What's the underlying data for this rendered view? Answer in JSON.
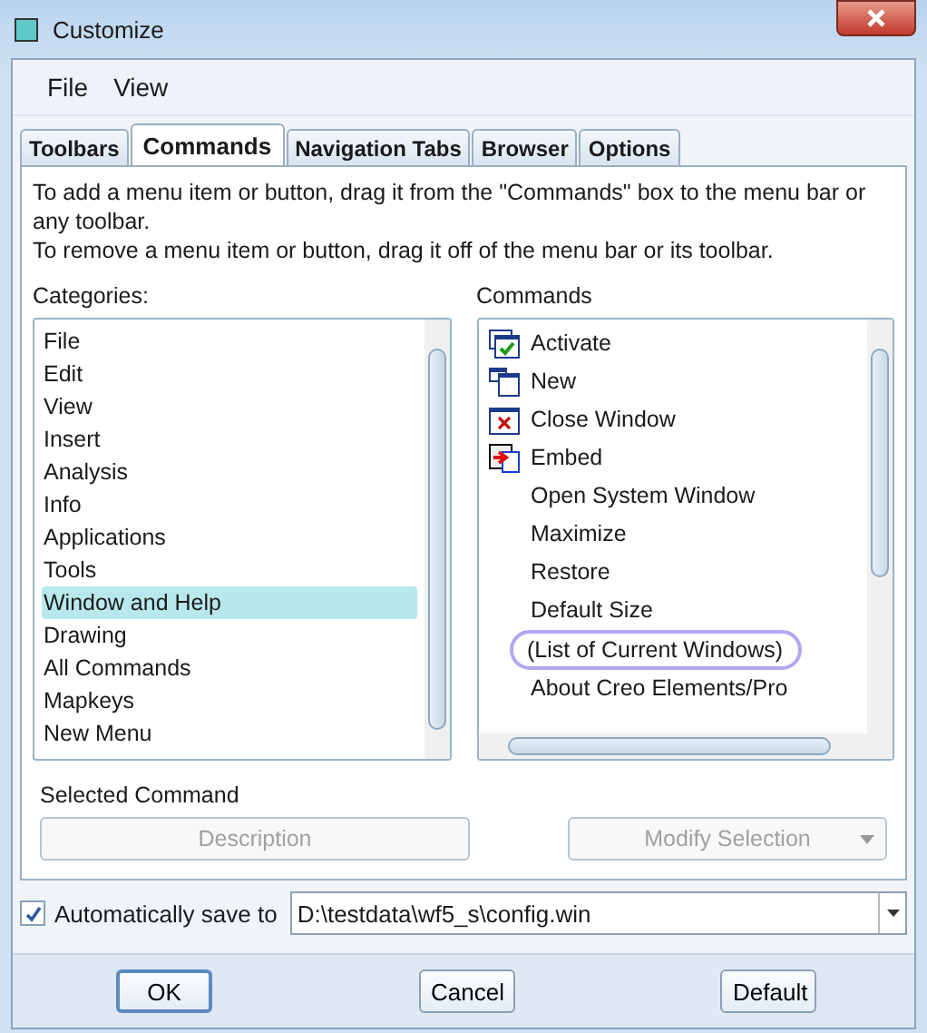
{
  "window": {
    "title": "Customize"
  },
  "menu": [
    "File",
    "View"
  ],
  "tabs": [
    {
      "label": "Toolbars",
      "selected": false
    },
    {
      "label": "Commands",
      "selected": true
    },
    {
      "label": "Navigation Tabs",
      "selected": false
    },
    {
      "label": "Browser",
      "selected": false
    },
    {
      "label": "Options",
      "selected": false
    }
  ],
  "instructions": [
    "To add a menu item or button, drag it from the \"Commands\" box to the menu bar or any toolbar.",
    "To remove a menu item or button, drag it off of the menu bar or its toolbar."
  ],
  "categories": {
    "label": "Categories:",
    "items": [
      {
        "label": "File",
        "selected": false
      },
      {
        "label": "Edit",
        "selected": false
      },
      {
        "label": "View",
        "selected": false
      },
      {
        "label": "Insert",
        "selected": false
      },
      {
        "label": "Analysis",
        "selected": false
      },
      {
        "label": "Info",
        "selected": false
      },
      {
        "label": "Applications",
        "selected": false
      },
      {
        "label": "Tools",
        "selected": false
      },
      {
        "label": "Window and Help",
        "selected": true
      },
      {
        "label": "Drawing",
        "selected": false
      },
      {
        "label": "All Commands",
        "selected": false
      },
      {
        "label": "Mapkeys",
        "selected": false
      },
      {
        "label": "New Menu",
        "selected": false
      }
    ]
  },
  "commands": {
    "label": "Commands",
    "items": [
      {
        "label": "Activate",
        "kind": "icon",
        "circled": false
      },
      {
        "label": "New",
        "kind": "icon",
        "circled": false
      },
      {
        "label": "Close Window",
        "kind": "icon",
        "circled": false
      },
      {
        "label": "Embed",
        "kind": "icon",
        "circled": false
      },
      {
        "label": "Open System Window",
        "kind": "plain",
        "circled": false
      },
      {
        "label": "Maximize",
        "kind": "plain",
        "circled": false
      },
      {
        "label": "Restore",
        "kind": "plain",
        "circled": false
      },
      {
        "label": "Default Size",
        "kind": "plain",
        "circled": false
      },
      {
        "label": "(List of Current Windows)",
        "kind": "plain",
        "circled": true
      },
      {
        "label": "About Creo Elements/Pro",
        "kind": "plain",
        "circled": false
      }
    ]
  },
  "selected_command": {
    "label": "Selected Command",
    "description_button": {
      "label": "Description",
      "disabled": true
    },
    "modify_button": {
      "label": "Modify Selection",
      "disabled": true
    }
  },
  "autosave": {
    "label": "Automatically save to",
    "checked": true,
    "value": "D:\\testdata\\wf5_s\\config.win"
  },
  "buttons": [
    {
      "label": "OK",
      "default": true
    },
    {
      "label": "Cancel",
      "default": false
    },
    {
      "label": "Default",
      "default": false
    }
  ]
}
